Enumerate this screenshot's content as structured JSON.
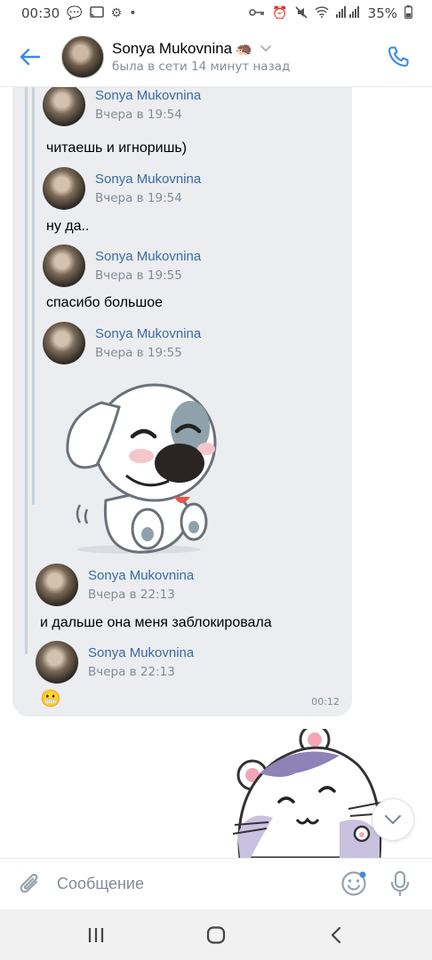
{
  "status_bar": {
    "time": "00:30",
    "battery": "35%"
  },
  "header": {
    "contact_name": "Sonya Mukovnina",
    "name_emoji": "🦔",
    "last_seen": "была в сети 14 минут назад"
  },
  "forwarded_messages": [
    {
      "sender": "Sonya Mukovnina",
      "time": "Вчера в 19:54",
      "text": "читаешь и игноришь)"
    },
    {
      "sender": "Sonya Mukovnina",
      "time": "Вчера в 19:54",
      "text": "ну да.."
    },
    {
      "sender": "Sonya Mukovnina",
      "time": "Вчера в 19:55",
      "text": "спасибо большое"
    },
    {
      "sender": "Sonya Mukovnina",
      "time": "Вчера в 19:55",
      "text": ""
    },
    {
      "sender": "Sonya Mukovnina",
      "time": "Вчера в 22:13",
      "text": "и дальше она меня заблокировала"
    },
    {
      "sender": "Sonya Mukovnina",
      "time": "Вчера в 22:13",
      "text": "😬"
    }
  ],
  "bubble_time": "00:12",
  "composer": {
    "placeholder": "Сообщение"
  },
  "icons": {
    "back": "arrow-left-icon",
    "call": "phone-icon",
    "attach": "paperclip-icon",
    "emoji": "smiley-icon",
    "mic": "microphone-icon",
    "scroll_down": "chevron-down-icon"
  },
  "colors": {
    "accent": "#3f8ae0",
    "bubble": "#ebedf0",
    "sender_name": "#3a6aa0",
    "secondary_text": "#818c99"
  }
}
